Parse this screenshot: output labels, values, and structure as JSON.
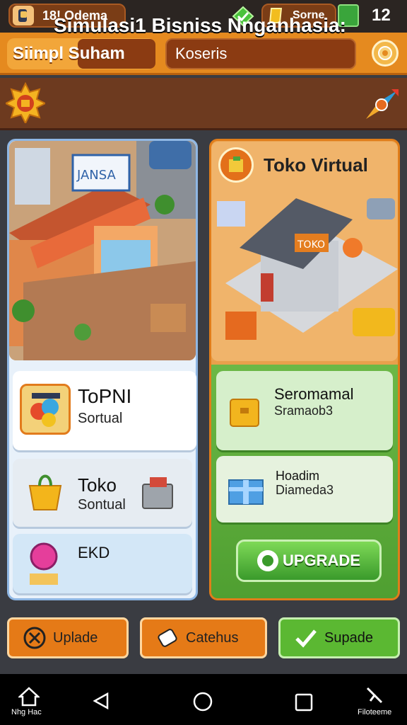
{
  "statusbar": {
    "player_name": "18! Odema",
    "coins": "Sorne",
    "level": "12"
  },
  "navbar": {
    "tab_label": "Siimpl Suham",
    "search_text": "Koseris"
  },
  "banner": {
    "title": "Simulasi1 Bisniss Nnganhasia:"
  },
  "left_panel": {
    "sign_text": "JANSA",
    "cards": [
      {
        "title": "ToPNI",
        "subtitle": "Sortual"
      },
      {
        "title": "Toko",
        "subtitle": "Sontual"
      },
      {
        "title": "EKD",
        "subtitle": ""
      }
    ]
  },
  "right_panel": {
    "title": "Toko Virtual",
    "store_sign": "TOKO",
    "cards": [
      {
        "title": "Seromamal",
        "subtitle": "Sramaob3"
      },
      {
        "title": "Hoadim",
        "subtitle": "Diameda3"
      }
    ],
    "upgrade_label": "UPGRADE"
  },
  "bottom_buttons": [
    {
      "label": "Uplade"
    },
    {
      "label": "Catehus"
    },
    {
      "label": "Supade"
    }
  ],
  "system_nav": {
    "home_label": "Nhg Hac",
    "files_label": "Filoteeme"
  },
  "colors": {
    "orange": "#e58a1f",
    "brown": "#6d3a1f",
    "green": "#5bb832",
    "blue_panel": "#e8f1fa"
  }
}
